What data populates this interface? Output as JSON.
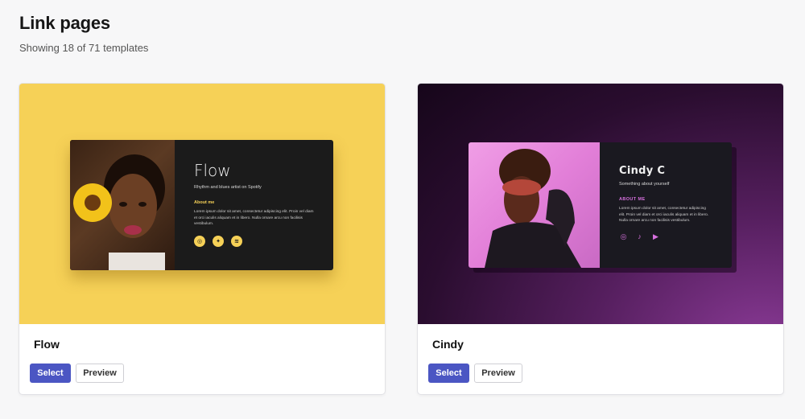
{
  "header": {
    "title": "Link pages",
    "subtitle": "Showing 18 of 71 templates"
  },
  "templates": [
    {
      "name": "Flow",
      "select_label": "Select",
      "preview_label": "Preview",
      "accent": "#f6d157",
      "mock": {
        "title": "Flow",
        "tagline": "Rhythm and blues artist on Spotify",
        "section": "About me",
        "text": "Lorem ipsum dolor sit amet, consectetur adipiscing elit. Proin vel diam et orci iaculis aliquam et in libero. Nulla ornare arcu non facilisis vestibulum.",
        "socials": [
          "instagram-icon",
          "twitter-icon",
          "spotify-icon"
        ]
      }
    },
    {
      "name": "Cindy",
      "select_label": "Select",
      "preview_label": "Preview",
      "accent": "#d871df",
      "mock": {
        "title": "Cindy C",
        "tagline": "Something about yourself",
        "section": "ABOUT ME",
        "text": "Lorem ipsum dolor sit amet, consectetur adipiscing elit. Proin vel diam et orci iaculis aliquam et in libero. Nulla ornare arcu non facilisis vestibulum.",
        "socials": [
          "instagram-icon",
          "tiktok-icon",
          "youtube-icon"
        ]
      }
    }
  ],
  "colors": {
    "primary_button": "#4b56c3",
    "background": "#f7f7f8"
  }
}
